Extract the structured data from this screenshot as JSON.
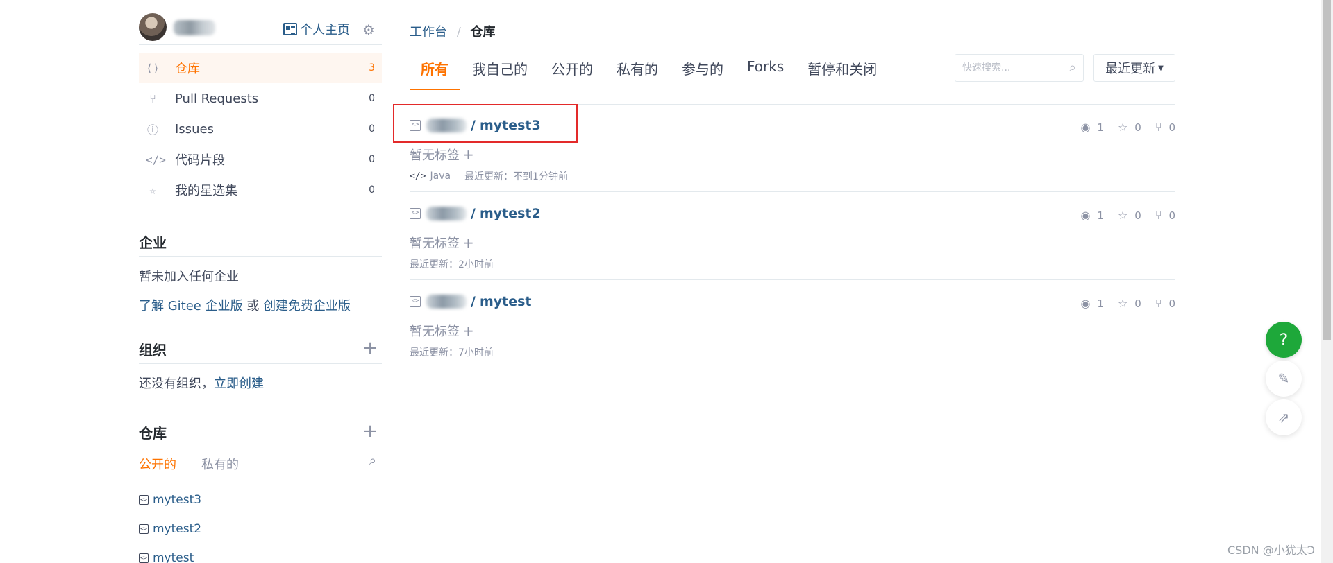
{
  "profile": {
    "homepage_label": "个人主页"
  },
  "nav": {
    "items": [
      {
        "label": "仓库",
        "count": "3",
        "icon": "repo-icon",
        "glyph": "⟨⟩"
      },
      {
        "label": "Pull Requests",
        "count": "0",
        "icon": "pull-request-icon",
        "glyph": "⑂"
      },
      {
        "label": "Issues",
        "count": "0",
        "icon": "issue-icon",
        "glyph": "ⓘ"
      },
      {
        "label": "代码片段",
        "count": "0",
        "icon": "code-snippet-icon",
        "glyph": "</>"
      },
      {
        "label": "我的星选集",
        "count": "0",
        "icon": "star-icon",
        "glyph": "☆"
      }
    ]
  },
  "enterprise": {
    "title": "企业",
    "empty_text": "暂未加入任何企业",
    "link1": "了解 Gitee 企业版",
    "or": " 或 ",
    "link2": "创建免费企业版"
  },
  "organization": {
    "title": "组织",
    "empty_text": "还没有组织，",
    "create_link": "立即创建"
  },
  "repos_side": {
    "title": "仓库",
    "tab_public": "公开的",
    "tab_private": "私有的",
    "items": [
      "mytest3",
      "mytest2",
      "mytest"
    ]
  },
  "breadcrumb": {
    "workbench": "工作台",
    "separator": "/",
    "current": "仓库"
  },
  "tabs": [
    "所有",
    "我自己的",
    "公开的",
    "私有的",
    "参与的",
    "Forks",
    "暂停和关闭"
  ],
  "search": {
    "placeholder": "快速搜索..."
  },
  "sort": {
    "label": "最近更新"
  },
  "repos": [
    {
      "name": "mytest3",
      "tags_text": "暂无标签",
      "language": "Java",
      "updated": "最近更新：不到1分钟前",
      "watch": "1",
      "star": "0",
      "fork": "0"
    },
    {
      "name": "mytest2",
      "tags_text": "暂无标签",
      "language": "",
      "updated": "最近更新：2小时前",
      "watch": "1",
      "star": "0",
      "fork": "0"
    },
    {
      "name": "mytest",
      "tags_text": "暂无标签",
      "language": "",
      "updated": "最近更新：7小时前",
      "watch": "1",
      "star": "0",
      "fork": "0"
    }
  ],
  "floating": {
    "help_glyph": "?"
  },
  "watermark": "CSDN @小犹太Ͻ",
  "colors": {
    "accent": "#fe7300",
    "link": "#2a5d8a",
    "help_button": "#1ea83a",
    "highlight_box": "#e32a2a"
  }
}
